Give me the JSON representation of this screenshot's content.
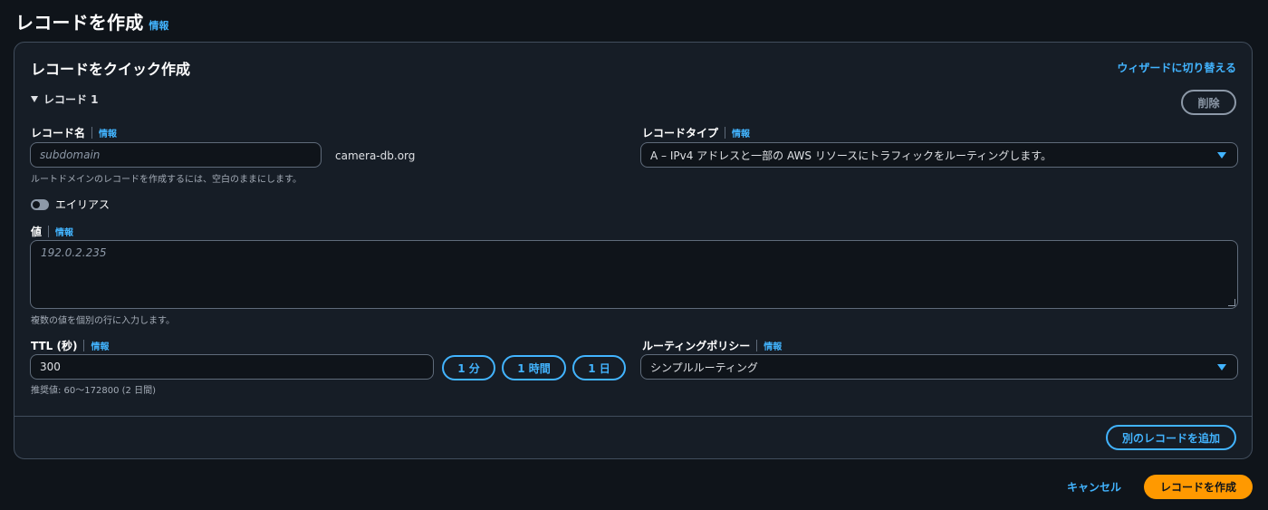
{
  "page": {
    "title": "レコードを作成",
    "info": "情報"
  },
  "quick_create": {
    "title": "レコードをクイック作成",
    "wizard_link": "ウィザードに切り替える",
    "record_header": "レコード 1",
    "delete_label": "削除",
    "record_name": {
      "label": "レコード名",
      "info": "情報",
      "placeholder": "subdomain",
      "domain_suffix": "camera-db.org",
      "hint": "ルートドメインのレコードを作成するには、空白のままにします。"
    },
    "record_type": {
      "label": "レコードタイプ",
      "info": "情報",
      "selected": "A – IPv4 アドレスと一部の AWS リソースにトラフィックをルーティングします。"
    },
    "alias": {
      "label": "エイリアス",
      "enabled": false
    },
    "value": {
      "label": "値",
      "info": "情報",
      "placeholder": "192.0.2.235",
      "hint": "複数の値を個別の行に入力します。"
    },
    "ttl": {
      "label": "TTL (秒)",
      "info": "情報",
      "value": "300",
      "hint": "推奨値: 60～172800 (2 日間)",
      "presets": [
        "1 分",
        "1 時間",
        "1 日"
      ]
    },
    "routing_policy": {
      "label": "ルーティングポリシー",
      "info": "情報",
      "selected": "シンプルルーティング"
    },
    "add_record_label": "別のレコードを追加"
  },
  "footer": {
    "cancel_label": "キャンセル",
    "create_label": "レコードを作成"
  },
  "colors": {
    "background": "#0f141a",
    "panel": "#161d26",
    "link": "#42b4ff",
    "primary_button": "#ff9900"
  }
}
